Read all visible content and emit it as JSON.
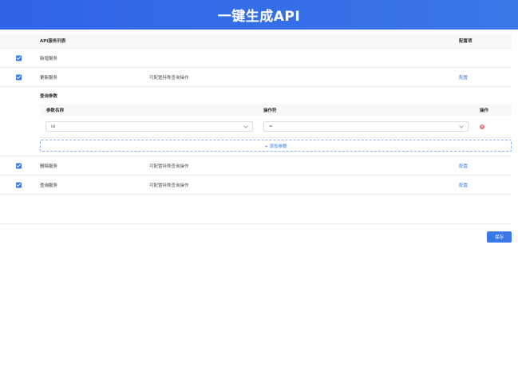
{
  "header": {
    "title": "一键生成API"
  },
  "table": {
    "columns": {
      "service_list": "API服务列表",
      "config": "配置项"
    },
    "rows": [
      {
        "name": "新增服务",
        "checked": true,
        "desc": "",
        "config_link": ""
      },
      {
        "name": "更新服务",
        "checked": true,
        "desc": "可配置特殊查询操作",
        "config_link": "配置"
      },
      {
        "name": "删除服务",
        "checked": true,
        "desc": "可配置特殊查询操作",
        "config_link": "配置"
      },
      {
        "name": "查询服务",
        "checked": true,
        "desc": "可配置特殊查询操作",
        "config_link": "配置"
      }
    ]
  },
  "query_params": {
    "title": "查询参数",
    "columns": {
      "param_name": "参数名称",
      "operator": "操作符",
      "action": "操作"
    },
    "rows": [
      {
        "param_name": "id",
        "operator": "="
      }
    ],
    "add_label": "+ 添加参数"
  },
  "footer": {
    "save_label": "保存"
  },
  "icons": {
    "check": "checkbox-checked-icon",
    "chevron": "chevron-down-icon",
    "delete": "remove-circle-icon"
  },
  "colors": {
    "primary": "#3a78e8",
    "danger": "#f56c6c"
  }
}
